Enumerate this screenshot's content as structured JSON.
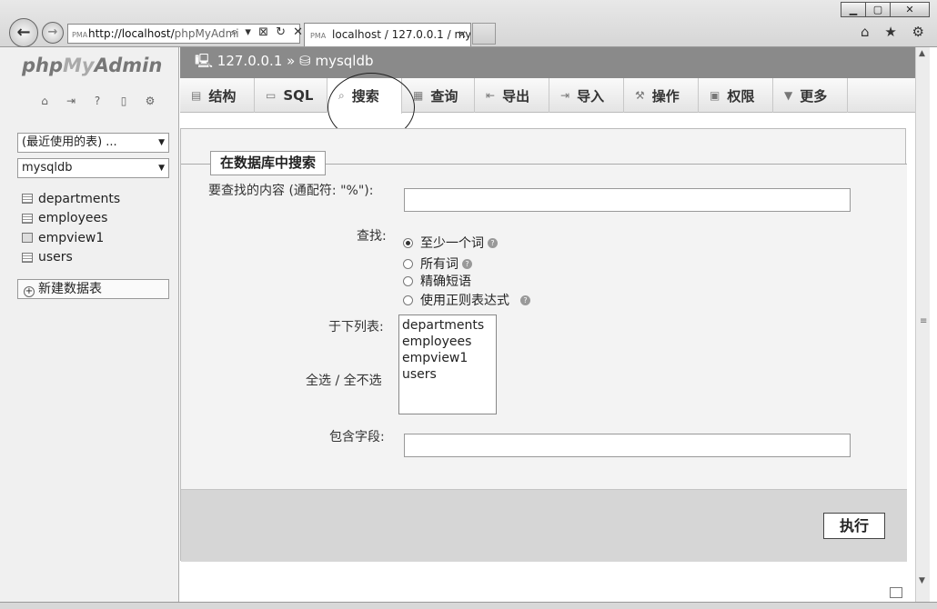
{
  "browser": {
    "window_buttons": {
      "minimize": "▁",
      "maximize": "▢",
      "close": "✕"
    },
    "address_host": "http://localhost/",
    "address_rest": "phpMyAdmi",
    "address_tools": "⌕ ▾ ⊠ ↻ ✕",
    "favicon": "PMA",
    "tab_title": "localhost / 127.0.0.1 / my...",
    "tab_close": "✕",
    "toolbar_icons": "⌂ ★ ⚙"
  },
  "sidebar": {
    "logo_php": "php",
    "logo_my": "My",
    "logo_admin": "Admin",
    "icons": [
      "home-icon",
      "logout-icon",
      "help-icon",
      "docs-icon",
      "settings-icon"
    ],
    "recent_select": "(最近使用的表) ...",
    "db_select": "mysqldb",
    "tables": [
      {
        "name": "departments",
        "icon": "table-icon"
      },
      {
        "name": "employees",
        "icon": "table-icon"
      },
      {
        "name": "empview1",
        "icon": "view-icon"
      },
      {
        "name": "users",
        "icon": "table-icon"
      }
    ],
    "new_table": "新建数据表"
  },
  "breadcrumb": {
    "server": "127.0.0.1",
    "separator": "»",
    "database": "mysqldb"
  },
  "tabs": [
    {
      "label": "结构",
      "icon": "structure-icon"
    },
    {
      "label": "SQL",
      "icon": "sql-icon"
    },
    {
      "label": "搜索",
      "icon": "search-icon",
      "active": true
    },
    {
      "label": "查询",
      "icon": "query-icon"
    },
    {
      "label": "导出",
      "icon": "export-icon"
    },
    {
      "label": "导入",
      "icon": "import-icon"
    },
    {
      "label": "操作",
      "icon": "operations-icon"
    },
    {
      "label": "权限",
      "icon": "privileges-icon"
    },
    {
      "label": "更多",
      "icon": "chevron-down-icon"
    }
  ],
  "form": {
    "legend": "在数据库中搜索",
    "search_label": "要查找的内容 (通配符: \"%\"):",
    "search_value": "",
    "find_label": "查找:",
    "options": [
      {
        "label": "至少一个词",
        "checked": true,
        "help": true
      },
      {
        "label": "所有词",
        "checked": false,
        "help": true
      },
      {
        "label": "精确短语",
        "checked": false,
        "help": false
      },
      {
        "label": "使用正则表达式",
        "checked": false,
        "help": true
      }
    ],
    "in_tables_label": "于下列表:",
    "select_all": "全选 / 全不选",
    "table_options": [
      "departments",
      "employees",
      "empview1",
      "users"
    ],
    "column_label": "包含字段:",
    "column_value": "",
    "submit": "执行"
  }
}
